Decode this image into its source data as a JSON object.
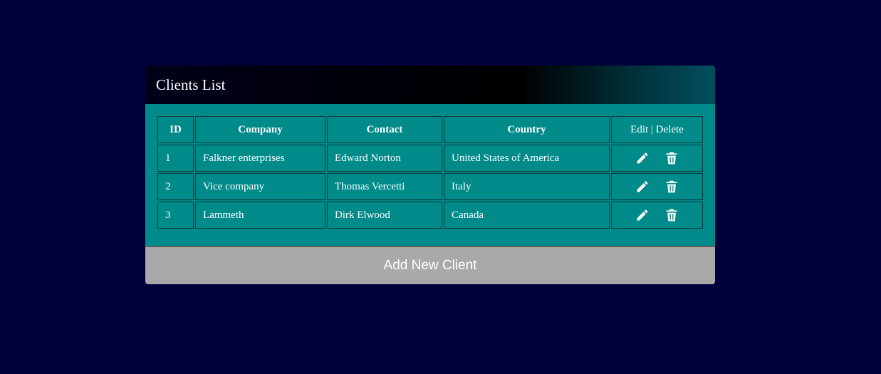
{
  "panel": {
    "title": "Clients List"
  },
  "table": {
    "headers": {
      "id": "ID",
      "company": "Company",
      "contact": "Contact",
      "country": "Country",
      "actions": "Edit | Delete"
    },
    "rows": [
      {
        "id": "1",
        "company": "Falkner enterprises",
        "contact": "Edward Norton",
        "country": "United States of America"
      },
      {
        "id": "2",
        "company": "Vice company",
        "contact": "Thomas Vercetti",
        "country": "Italy"
      },
      {
        "id": "3",
        "company": "Lammeth",
        "contact": "Dirk Elwood",
        "country": "Canada"
      }
    ],
    "row_icons": {
      "edit": "pencil-icon",
      "delete": "trash-icon"
    }
  },
  "footer": {
    "add_label": "Add New Client"
  },
  "colors": {
    "page_background": "#00003a",
    "panel_body": "#008a8a",
    "footer_button": "#a9a9a9",
    "text": "#ffffff"
  }
}
